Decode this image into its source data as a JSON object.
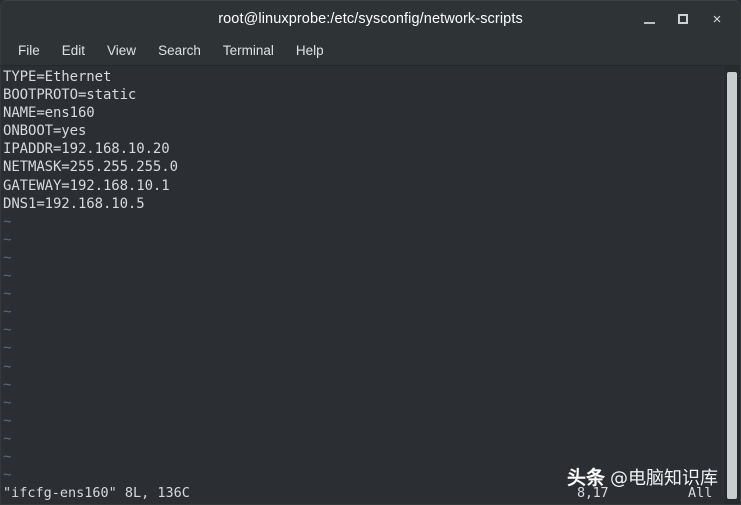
{
  "window": {
    "title": "root@linuxprobe:/etc/sysconfig/network-scripts",
    "buttons": {
      "minimize": "minimize-icon",
      "maximize": "maximize-icon",
      "close": "×"
    }
  },
  "menubar": {
    "items": [
      {
        "label": "File"
      },
      {
        "label": "Edit"
      },
      {
        "label": "View"
      },
      {
        "label": "Search"
      },
      {
        "label": "Terminal"
      },
      {
        "label": "Help"
      }
    ]
  },
  "editor": {
    "lines": [
      "TYPE=Ethernet",
      "BOOTPROTO=static",
      "NAME=ens160",
      "ONBOOT=yes",
      "IPADDR=192.168.10.20",
      "NETMASK=255.255.255.0",
      "GATEWAY=192.168.10.1",
      "DNS1=192.168.10.5"
    ],
    "empty_marker": "~",
    "empty_marker_count": 16,
    "status": {
      "file_info": "\"ifcfg-ens160\" 8L, 136C",
      "cursor_position": "8,17",
      "scroll_scope": "All"
    }
  },
  "watermark": {
    "brand": "头条",
    "handle": "@电脑知识库"
  },
  "colors": {
    "titlebar_bg": "#2e3436",
    "terminal_bg": "#2b2e32",
    "text": "#d6dade",
    "tilde": "#5c6b78",
    "scrollbar_thumb": "#c8cdd0"
  }
}
